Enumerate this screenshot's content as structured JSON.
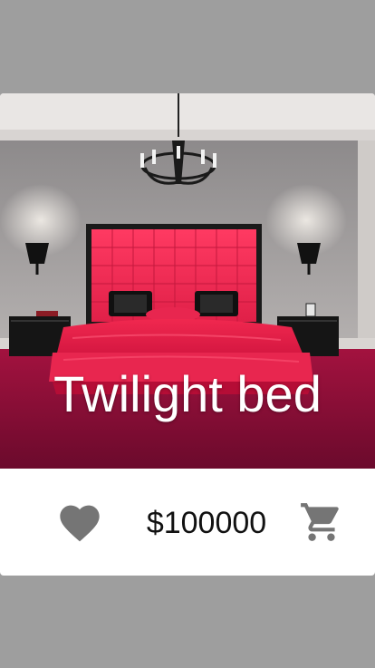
{
  "product": {
    "title": "Twilight bed",
    "price": "$100000",
    "image_alt": "Bedroom with red tufted bed and black chandelier"
  },
  "icons": {
    "favorite": "heart-icon",
    "cart": "cart-icon"
  },
  "colors": {
    "background": "#9e9e9e",
    "card": "#ffffff",
    "icon": "#757575",
    "price_text": "#111111",
    "title_text": "#ffffff",
    "bed_red": "#e8264f",
    "carpet": "#8c0f3a"
  }
}
